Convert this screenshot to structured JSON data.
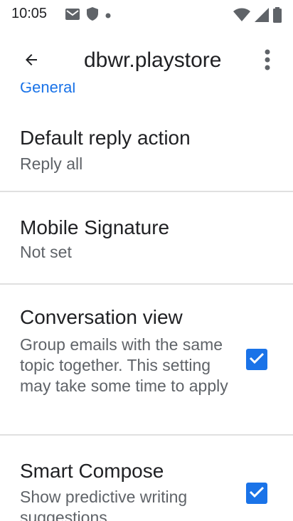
{
  "status_bar": {
    "time": "10:05",
    "icons": [
      "gmail-icon",
      "shield-icon",
      "dot-icon",
      "wifi-icon",
      "signal-icon",
      "battery-icon"
    ]
  },
  "app_bar": {
    "title": "dbwr.playstore",
    "back_icon": "arrow-back-icon",
    "overflow_icon": "more-vert-icon"
  },
  "section": {
    "header": "General"
  },
  "prefs": {
    "default_reply": {
      "title": "Default reply action",
      "summary": "Reply all"
    },
    "mobile_signature": {
      "title": "Mobile Signature",
      "summary": "Not set"
    },
    "conversation_view": {
      "title": "Conversation view",
      "summary": "Group emails with the same topic together. This setting may take some time to apply",
      "checked": true
    },
    "smart_compose": {
      "title": "Smart Compose",
      "summary": "Show predictive writing suggestions",
      "checked": true
    }
  },
  "colors": {
    "accent": "#1a73e8",
    "divider": "#e0e0e0",
    "text_primary": "#202124",
    "text_secondary": "#5f6368"
  }
}
